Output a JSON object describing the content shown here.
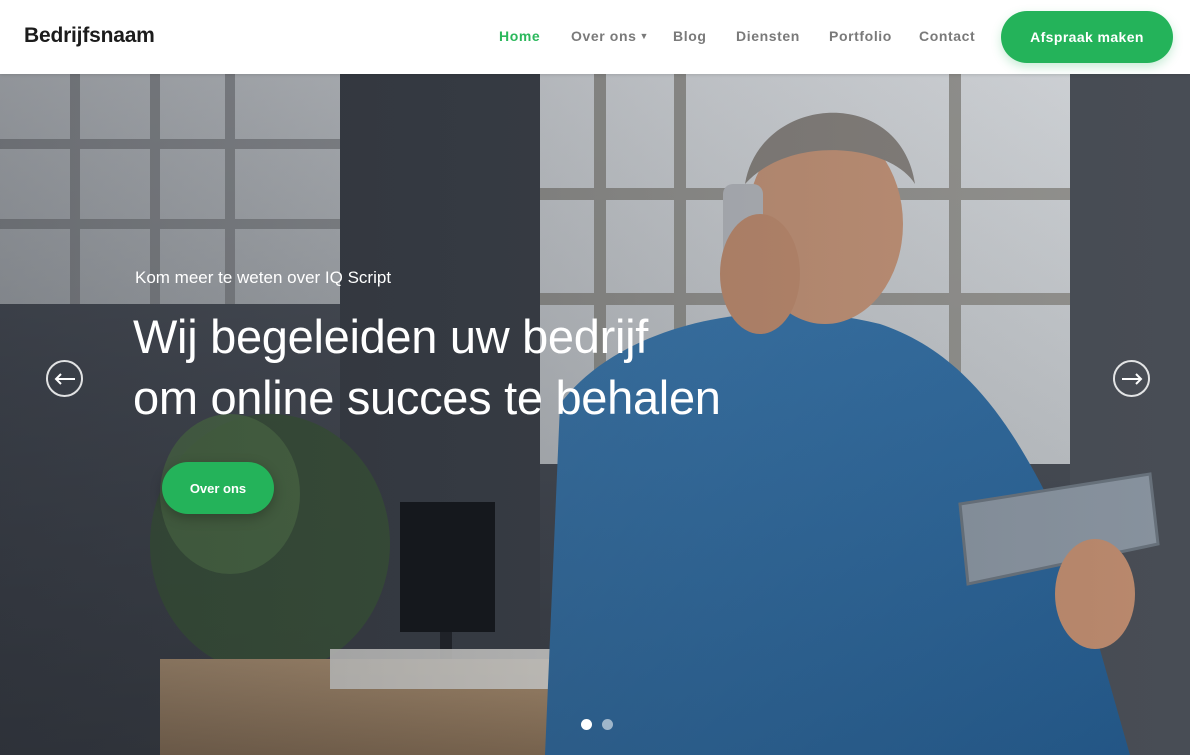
{
  "header": {
    "brand": "Bedrijfsnaam",
    "nav": [
      {
        "label": "Home",
        "active": true
      },
      {
        "label": "Over ons",
        "has_dropdown": true
      },
      {
        "label": "Blog"
      },
      {
        "label": "Diensten"
      },
      {
        "label": "Portfolio"
      },
      {
        "label": "Contact"
      }
    ],
    "cta_label": "Afspraak maken"
  },
  "hero": {
    "kicker": "Kom meer te weten over IQ Script",
    "headline_line1": "Wij begeleiden uw bedrijf",
    "headline_line2": "om online succes te behalen",
    "button_label": "Over ons",
    "prev_icon": "arrow-left-icon",
    "next_icon": "arrow-right-icon",
    "slides_total": 2,
    "slide_active": 1
  },
  "colors": {
    "accent": "#24b35a",
    "nav_active": "#2bb85c",
    "nav_text": "#7a7a7a",
    "brand_text": "#1c1c1c"
  }
}
